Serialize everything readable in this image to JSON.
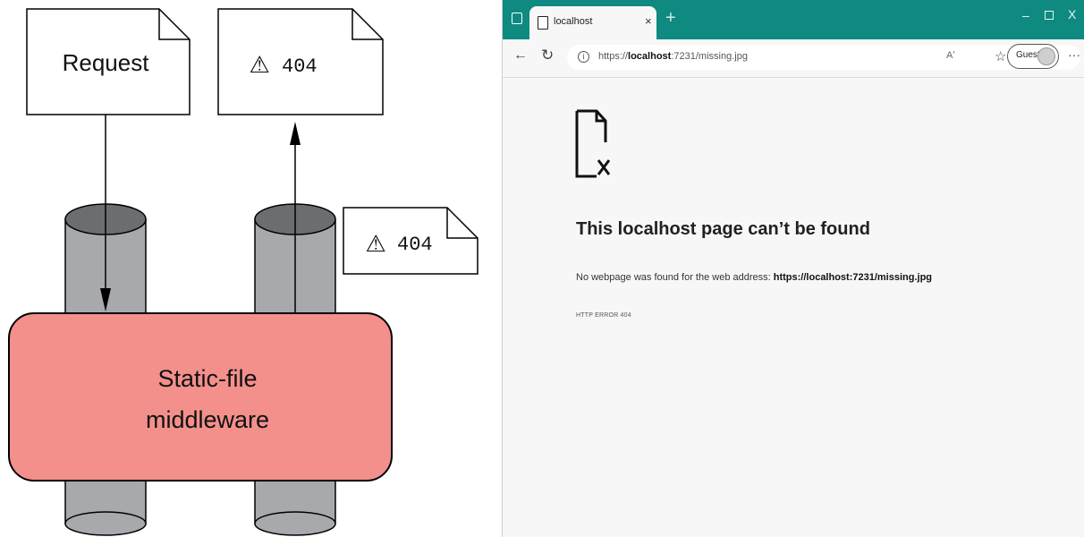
{
  "diagram": {
    "request_label": "Request",
    "response_label": "404",
    "inner_response_label": "404",
    "warning_symbol": "⚠",
    "middleware_label_line1": "Static-file",
    "middleware_label_line2": "middleware",
    "middleware_color": "#f4908c",
    "pipe_color": "#a7a9ac",
    "pipe_top_color": "#6b6d70"
  },
  "browser": {
    "accent_color": "#0e8a80",
    "tab_title": "localhost",
    "tab_close": "×",
    "new_tab": "+",
    "window_controls": {
      "minimize": "–",
      "close": "X"
    },
    "url_prefix": "https://",
    "url_host": "localhost",
    "url_rest": ":7231/missing.jpg",
    "read_aloud": "Aʹ",
    "profile_label": "Guest",
    "menu": "···",
    "icons": [
      "tab-actions-icon",
      "page-favicon",
      "back-arrow-icon",
      "refresh-icon",
      "info-icon",
      "read-aloud-icon",
      "favorites-icon",
      "avatar-icon",
      "more-menu-icon",
      "broken-file-icon"
    ],
    "error": {
      "title": "This localhost page can’t be found",
      "description": "No webpage was found for the web address:",
      "url": "https://localhost:7231/missing.jpg",
      "code": "HTTP ERROR 404"
    }
  }
}
